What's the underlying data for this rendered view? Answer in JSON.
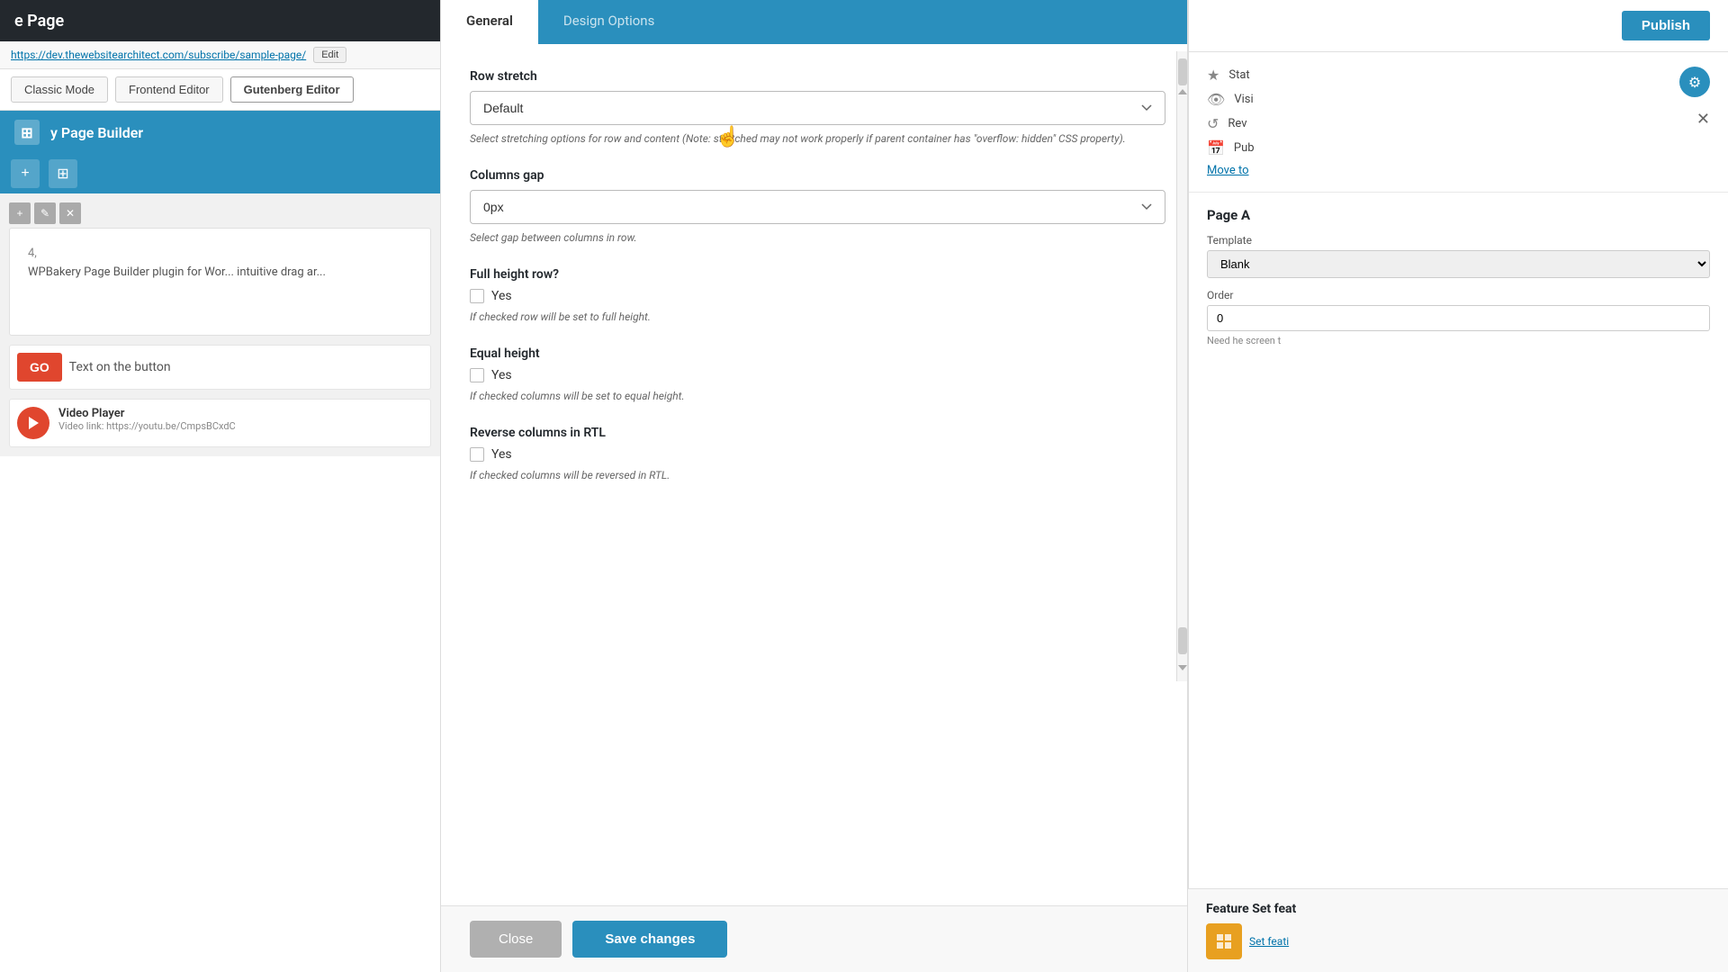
{
  "page": {
    "title": "e Page",
    "url": "https://dev.thewebsitearchitect.com/subscribe/sample-page/",
    "edit_label": "Edit"
  },
  "mode_bar": {
    "classic_label": "Classic Mode",
    "frontend_label": "Frontend Editor",
    "gutenberg_label": "Gutenberg Editor"
  },
  "builder": {
    "title": "y Page Builder",
    "add_row_icon": "+",
    "content_icon": "⊞"
  },
  "canvas": {
    "row_number": "4,",
    "content_text": "WPBakery Page Builder plugin for Wor... intuitive drag ar...",
    "button_go": "GO",
    "button_text": "Text on the button",
    "video_title": "Video Player",
    "video_url": "Video link: https://youtu.be/CmpsBCxdC"
  },
  "modal": {
    "tab_general": "General",
    "tab_design": "Design Options",
    "row_stretch_label": "Row stretch",
    "row_stretch_value": "Default",
    "row_stretch_help": "Select stretching options for row and content (Note: stretched may not work properly if parent container has \"overflow: hidden\" CSS property).",
    "columns_gap_label": "Columns gap",
    "columns_gap_value": "0px",
    "columns_gap_help": "Select gap between columns in row.",
    "full_height_label": "Full height row?",
    "full_height_checkbox": "Yes",
    "full_height_help": "If checked row will be set to full height.",
    "equal_height_label": "Equal height",
    "equal_height_checkbox": "Yes",
    "equal_height_help": "If checked columns will be set to equal height.",
    "reverse_rtl_label": "Reverse columns in RTL",
    "reverse_rtl_checkbox": "Yes",
    "reverse_rtl_help": "If checked columns will be reversed in RTL.",
    "close_label": "Close",
    "save_label": "Save changes"
  },
  "right_panel": {
    "publish_label": "Publish",
    "status_label": "Stat",
    "visibility_label": "Visi",
    "revision_label": "Rev",
    "published_label": "Pub",
    "settings_section": "Move to",
    "page_attribs_title": "Page A",
    "template_label": "Template",
    "template_value": "Blank",
    "order_label": "Order",
    "order_value": "0",
    "help_text": "Need he screen t",
    "feature_set_title": "Feature Set feat",
    "feature_icon_label": "Set feati"
  }
}
